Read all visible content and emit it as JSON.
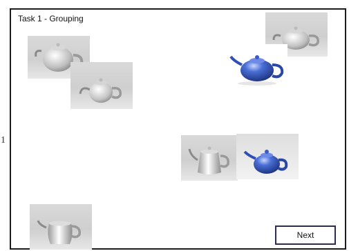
{
  "window": {
    "title": "Task 1 - Grouping",
    "stray_mark": "1"
  },
  "cards": [
    {
      "name": "teapot-card-1",
      "icon": "white-round-teapot-icon",
      "color": "#eaeaea"
    },
    {
      "name": "teapot-card-2",
      "icon": "white-small-teapot-icon",
      "color": "#eaeaea"
    },
    {
      "name": "teapot-card-3",
      "icon": "white-squat-teapot-icon",
      "color": "#eaeaea"
    },
    {
      "name": "teapot-card-4",
      "icon": "blue-teapot-icon",
      "color": "#2f4fb5"
    },
    {
      "name": "teapot-card-5",
      "icon": "white-tall-teapot-icon",
      "color": "#eaeaea"
    },
    {
      "name": "teapot-card-6",
      "icon": "blue-teapot-icon",
      "color": "#2f4fb5"
    },
    {
      "name": "teapot-card-7",
      "icon": "white-pitcher-teapot-icon",
      "color": "#eaeaea"
    }
  ],
  "buttons": {
    "next_label": "Next"
  },
  "colors": {
    "frame": "#1a1a1a",
    "button_border": "#2b2b55",
    "teapot_blue": "#2f4fb5",
    "teapot_white": "#eaeaea"
  }
}
